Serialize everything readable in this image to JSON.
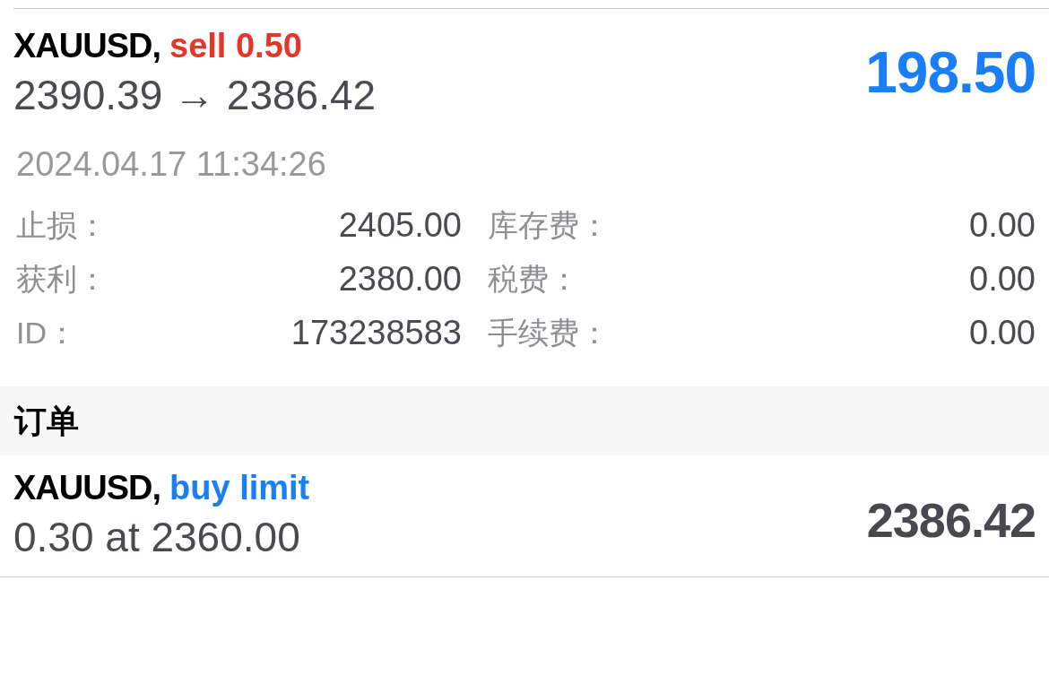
{
  "position": {
    "symbol": "XAUUSD,",
    "kind": "sell",
    "action": "sell 0.50",
    "prices": "2390.39 → 2386.42",
    "profit": "198.50",
    "time": "2024.04.17 11:34:26",
    "details": [
      {
        "label": "止损：",
        "value": "2405.00"
      },
      {
        "label": "库存费：",
        "value": "0.00"
      },
      {
        "label": "获利：",
        "value": "2380.00"
      },
      {
        "label": "税费：",
        "value": "0.00"
      },
      {
        "label": "ID：",
        "value": "173238583"
      },
      {
        "label": "手续费：",
        "value": "0.00"
      }
    ]
  },
  "orders_section": {
    "title": "订单",
    "orders": [
      {
        "symbol": "XAUUSD,",
        "kind": "buy",
        "action": "buy limit",
        "volume_price": "0.30 at 2360.00",
        "current_price": "2386.42"
      }
    ]
  }
}
